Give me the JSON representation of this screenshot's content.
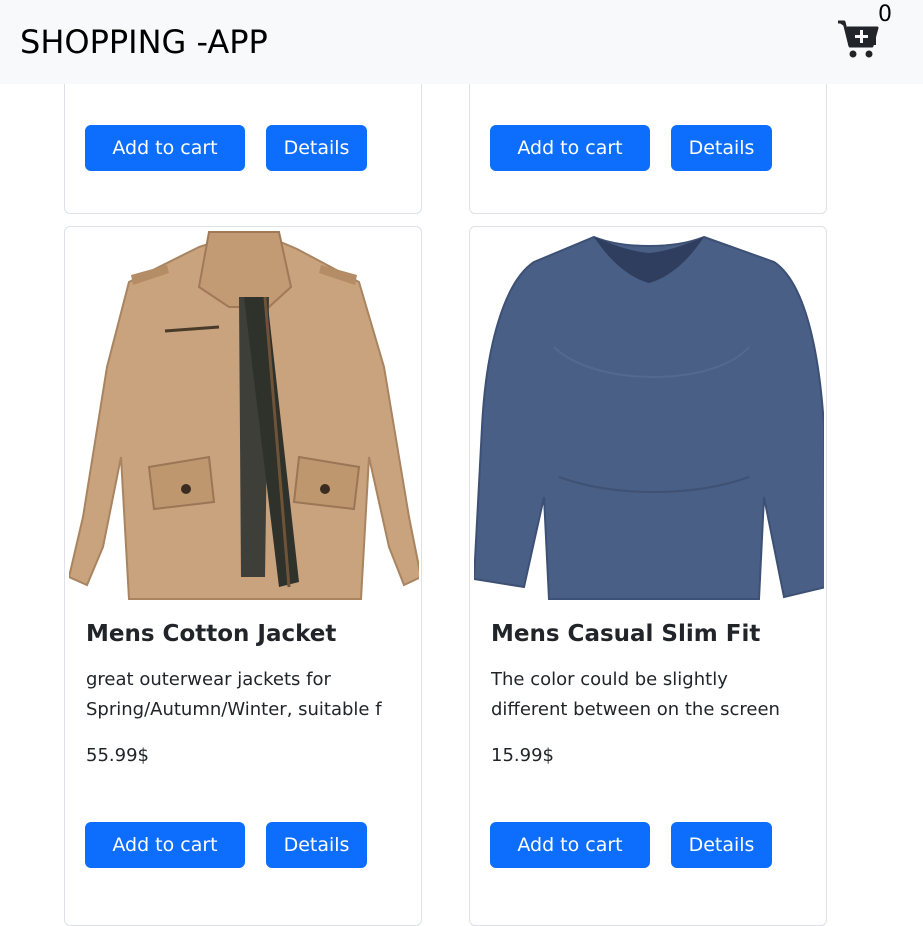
{
  "navbar": {
    "brand": "SHOPPING -APP",
    "cart_icon": "cart-plus-icon",
    "cart_count": "0"
  },
  "products_top": [
    {
      "add_label": "Add to cart",
      "details_label": "Details"
    },
    {
      "add_label": "Add to cart",
      "details_label": "Details"
    }
  ],
  "products": [
    {
      "image": "jacket-image",
      "title": "Mens Cotton Jacket",
      "description": "great outerwear jackets for Spring/Autumn/Winter, suitable f",
      "price": "55.99$",
      "add_label": "Add to cart",
      "details_label": "Details"
    },
    {
      "image": "tshirt-image",
      "title": "Mens Casual Slim Fit",
      "description": "The color could be slightly different between on the screen",
      "price": "15.99$",
      "add_label": "Add to cart",
      "details_label": "Details"
    }
  ],
  "colors": {
    "primary": "#0d6efd",
    "navbar_bg": "#f8f9fa",
    "jacket": "#c9a27e",
    "shirt": "#4a5f86"
  }
}
